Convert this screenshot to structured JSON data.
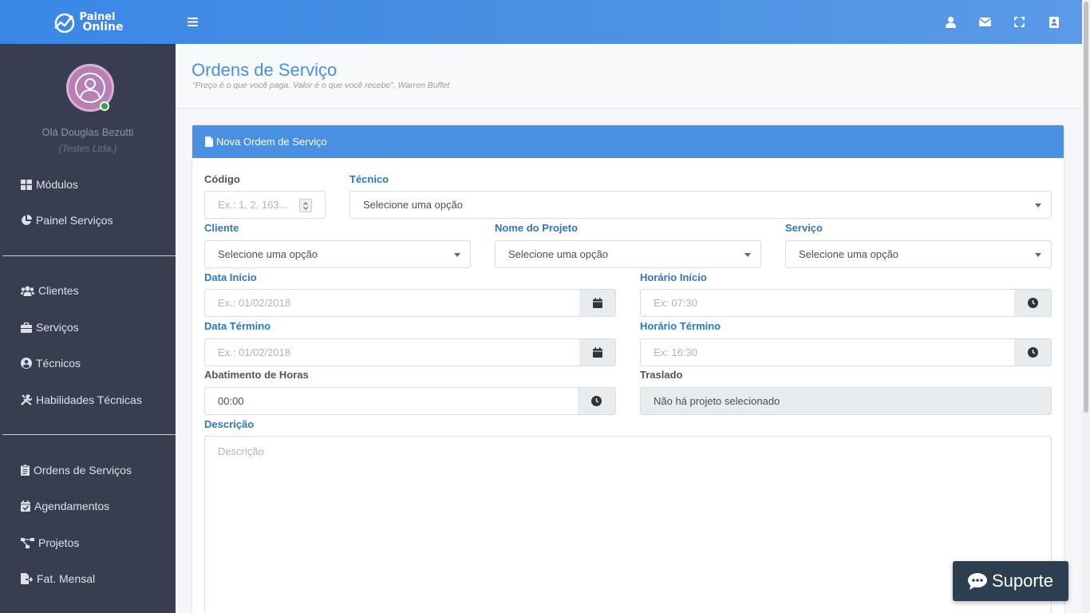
{
  "brand": {
    "line1": "Painel",
    "line2": "Online"
  },
  "topbar": {
    "icons": [
      "user-icon",
      "envelope-icon",
      "expand-icon",
      "address-book-icon"
    ]
  },
  "user": {
    "name": "Olá Douglas Bezutti",
    "company": "(Testes Ltda.)"
  },
  "sidebar": {
    "group1": [
      {
        "label": "Módulos",
        "icon": "grid-icon"
      },
      {
        "label": "Painel Serviços",
        "icon": "pie-chart-icon"
      }
    ],
    "group2": [
      {
        "label": "Clientes",
        "icon": "users-icon"
      },
      {
        "label": "Serviços",
        "icon": "briefcase-icon"
      },
      {
        "label": "Técnicos",
        "icon": "user-circle-icon"
      },
      {
        "label": "Habilidades Técnicas",
        "icon": "tools-icon"
      }
    ],
    "group3": [
      {
        "label": "Ordens de Serviços",
        "icon": "clipboard-icon"
      },
      {
        "label": "Agendamentos",
        "icon": "calendar-check-icon"
      },
      {
        "label": "Projetos",
        "icon": "project-diagram-icon"
      },
      {
        "label": "Fat. Mensal",
        "icon": "file-export-icon"
      }
    ]
  },
  "page": {
    "title": "Ordens de Serviço",
    "quote": "“Preço é o que você paga. Valor é o que você recebe”, Warren Buffet"
  },
  "card": {
    "title": "Nova Ordem de Serviço"
  },
  "form": {
    "codigo": {
      "label": "Código",
      "placeholder": "Ex.: 1, 2, 163..."
    },
    "tecnico": {
      "label": "Técnico",
      "value": "Selecione uma opção"
    },
    "cliente": {
      "label": "Cliente",
      "value": "Selecione uma opção"
    },
    "projeto": {
      "label": "Nome do Projeto",
      "value": "Selecione uma opção"
    },
    "servico": {
      "label": "Serviço",
      "value": "Selecione uma opção"
    },
    "data_inicio": {
      "label": "Data Início",
      "placeholder": "Ex.: 01/02/2018"
    },
    "horario_inicio": {
      "label": "Horário Início",
      "placeholder": "Ex: 07:30"
    },
    "data_termino": {
      "label": "Data Término",
      "placeholder": "Ex.: 01/02/2018"
    },
    "horario_termino": {
      "label": "Horário Término",
      "placeholder": "Ex: 16:30"
    },
    "abatimento": {
      "label": "Abatimento de Horas",
      "value": "00:00"
    },
    "traslado": {
      "label": "Traslado",
      "value": "Não há projeto selecionado"
    },
    "descricao": {
      "label": "Descrição",
      "placeholder": "Descrição"
    }
  },
  "support": {
    "label": "Suporte"
  },
  "colors": {
    "primary": "#4a90e2",
    "sidebar": "#383e4f",
    "label": "#2b77c3",
    "support": "#2c3e50"
  }
}
